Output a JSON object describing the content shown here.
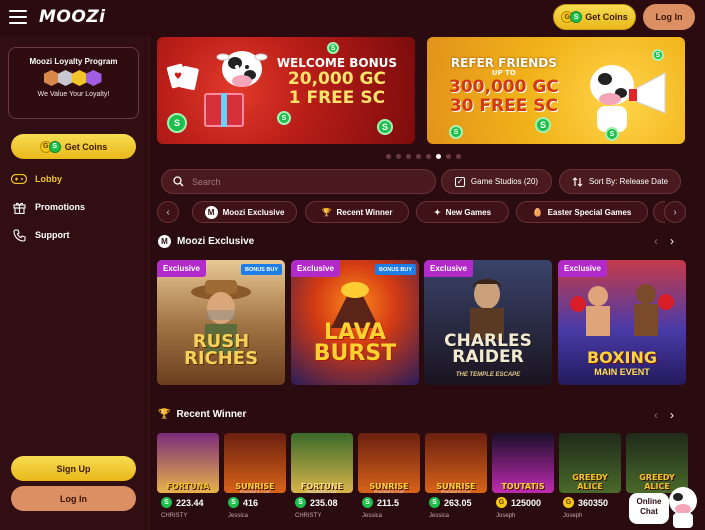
{
  "header": {
    "logo_text": "MOOZi",
    "get_coins_label": "Get Coins",
    "login_label": "Log In"
  },
  "sidebar": {
    "loyalty_title": "Moozi Loyalty Program",
    "loyalty_subtitle": "We Value Your Loyalty!",
    "get_coins_label": "Get Coins",
    "nav": [
      {
        "label": "Lobby",
        "icon": "controller-icon",
        "active": true
      },
      {
        "label": "Promotions",
        "icon": "gift-icon",
        "active": false
      },
      {
        "label": "Support",
        "icon": "phone-icon",
        "active": false
      }
    ],
    "signup_label": "Sign Up",
    "login_label": "Log In"
  },
  "banners": [
    {
      "line1": "WELCOME BONUS",
      "line2": "20,000 GC",
      "line3": "1 FREE SC"
    },
    {
      "line1": "REFER FRIENDS",
      "line_up": "UP TO",
      "line2": "300,000 GC",
      "line3": "30 FREE SC"
    }
  ],
  "carousel": {
    "dot_count": 8,
    "active_index": 5
  },
  "search": {
    "placeholder": "Search"
  },
  "filters": {
    "game_studios": "Game Studios (20)",
    "sort_by": "Sort By: Release Date"
  },
  "categories": [
    "Moozi Exclusive",
    "Recent Winner",
    "New Games",
    "Easter Special Games"
  ],
  "moozi_exclusive": {
    "title": "Moozi Exclusive",
    "games": [
      {
        "tag": "Exclusive",
        "bonus": "BONUS BUY",
        "title": "RUSH RICHES"
      },
      {
        "tag": "Exclusive",
        "bonus": "BONUS BUY",
        "title": "LAVA BURST"
      },
      {
        "tag": "Exclusive",
        "title": "CHARLES RAIDER",
        "subtitle": "THE TEMPLE ESCAPE"
      },
      {
        "tag": "Exclusive",
        "title": "BOXING",
        "subtitle": "MAIN EVENT"
      }
    ]
  },
  "recent_winner": {
    "title": "Recent Winner",
    "winners": [
      {
        "game": "FORTUNA",
        "amount": "223.44",
        "currency": "S",
        "user": "CHRISTY"
      },
      {
        "game": "SUNRISE",
        "provider": "PRAGMATIC PLAY",
        "amount": "416",
        "currency": "S",
        "user": "Jessica"
      },
      {
        "game": "FORTUNE",
        "provider": "PRAGMATIC PLAY",
        "amount": "235.08",
        "currency": "S",
        "user": "CHRISTY"
      },
      {
        "game": "SUNRISE",
        "provider": "PRAGMATIC PLAY",
        "amount": "211.5",
        "currency": "S",
        "user": "Jessica"
      },
      {
        "game": "SUNRISE",
        "provider": "PRAGMATIC PLAY",
        "amount": "263.05",
        "currency": "S",
        "user": "Jessica"
      },
      {
        "game": "TOUTATIS",
        "amount": "125000",
        "currency": "G",
        "user": "Joseph"
      },
      {
        "game": "GREEDY ALICE",
        "amount": "360350",
        "currency": "G",
        "user": "Joseph"
      },
      {
        "game": "GREEDY ALICE",
        "amount": "",
        "currency": "G",
        "user": "Joseph"
      }
    ]
  },
  "chat": {
    "label_line1": "Online",
    "label_line2": "Chat"
  },
  "colors": {
    "background": "#2a0c10",
    "accent_yellow": "#f0c52a",
    "login_orange": "#dc8f62",
    "exclusive_purple": "#b32aca",
    "sweeps_green": "#1fbf4e"
  }
}
